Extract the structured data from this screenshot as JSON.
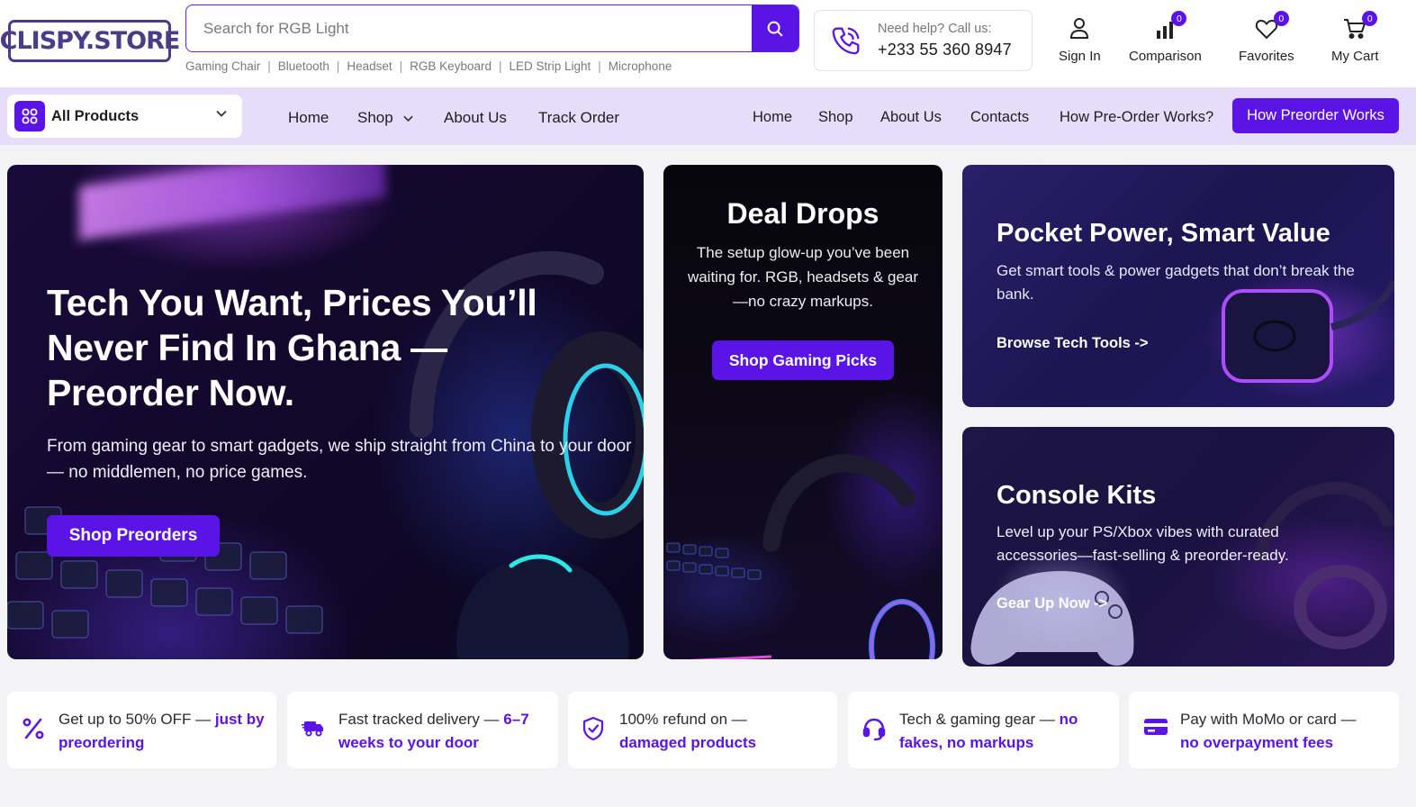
{
  "header": {
    "logo_text": "CLISPY.STORE",
    "search": {
      "placeholder": "Search for RGB Light",
      "icon": "search-icon"
    },
    "tags": [
      "Gaming Chair",
      "Bluetooth",
      "Headset",
      "RGB Keyboard",
      "LED Strip Light",
      "Microphone"
    ],
    "help": {
      "label": "Need help? Call us:",
      "phone": "+233 55 360 8947",
      "icon": "phone-icon"
    },
    "icons": [
      {
        "label": "Sign In",
        "icon": "user-icon"
      },
      {
        "label": "Comparison",
        "icon": "chart-icon",
        "badge": "0"
      },
      {
        "label": "Favorites",
        "icon": "heart-icon",
        "badge": "0"
      },
      {
        "label": "My Cart",
        "icon": "cart-icon",
        "badge": "0"
      }
    ]
  },
  "nav": {
    "all_products": "All Products",
    "left_links": [
      "Home",
      "Shop",
      "About Us",
      "Track Order"
    ],
    "right_links": [
      "Home",
      "Shop",
      "About Us",
      "Contacts",
      "How Pre-Order Works?"
    ],
    "cta": "How Preorder Works"
  },
  "hero": {
    "title": "Tech You Want, Prices You’ll Never Find In Ghana — Preorder Now.",
    "text": "From gaming gear to smart gadgets, we ship straight from China to your door — no middlemen, no price games.",
    "button": "Shop Preorders"
  },
  "deals": {
    "title": "Deal Drops",
    "text": "The setup glow-up you’ve been waiting for. RGB, headsets & gear —no crazy markups.",
    "button": "Shop Gaming Picks"
  },
  "pocket": {
    "title": "Pocket Power, Smart Value",
    "text": "Get smart tools & power gadgets that don’t break the bank.",
    "link": "Browse Tech Tools ->"
  },
  "console": {
    "title": "Console Kits",
    "text": "Level up your PS/Xbox vibes with curated accessories—fast-selling & preorder-ready.",
    "link": "Gear Up Now ->"
  },
  "features": [
    {
      "text": "Get up to 50% OFF — ",
      "highlight": "just by preordering",
      "icon": "percent-icon"
    },
    {
      "text": "Fast tracked delivery — ",
      "highlight": "6–7 weeks to your door",
      "icon": "truck-icon"
    },
    {
      "text": "100% refund on — ",
      "highlight": "damaged products",
      "icon": "shield-check-icon"
    },
    {
      "text": "Tech & gaming gear — ",
      "highlight": "no fakes, no markups",
      "icon": "headset-icon"
    },
    {
      "text": "Pay with MoMo or card — ",
      "highlight": "no overpayment fees",
      "icon": "card-icon"
    }
  ],
  "colors": {
    "accent": "#5b14e6",
    "nav_bg": "#e6ddfb",
    "logo": "#4b3c8a"
  }
}
